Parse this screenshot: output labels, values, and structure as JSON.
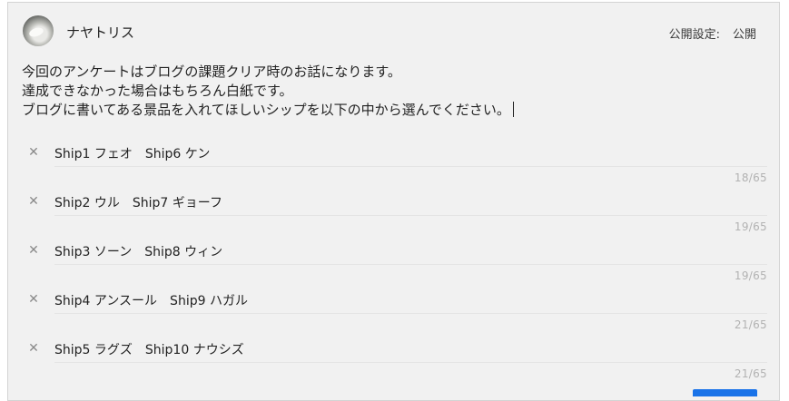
{
  "post": {
    "author": "ナヤトリス",
    "visibility_label": "公開設定:",
    "visibility_value": "公開",
    "body_lines": [
      "今回のアンケートはブログの課題クリア時のお話になります。",
      "達成できなかった場合はもちろん白紙です。",
      "ブログに書いてある景品を入れてほしいシップを以下の中から選んでください。"
    ]
  },
  "poll": {
    "remove_icon": "close-icon",
    "options": [
      {
        "text": "Ship1 フェオ　Ship6 ケン",
        "count": "18/65"
      },
      {
        "text": "Ship2 ウル　Ship7 ギョーフ",
        "count": "19/65"
      },
      {
        "text": "Ship3 ソーン　Ship8 ウィン",
        "count": "19/65"
      },
      {
        "text": "Ship4 アンスール　Ship9 ハガル",
        "count": "21/65"
      },
      {
        "text": "Ship5 ラグズ　Ship10 ナウシズ",
        "count": "21/65"
      }
    ]
  },
  "colors": {
    "accent": "#1a73e8",
    "card_bg": "#f1f1f1"
  }
}
